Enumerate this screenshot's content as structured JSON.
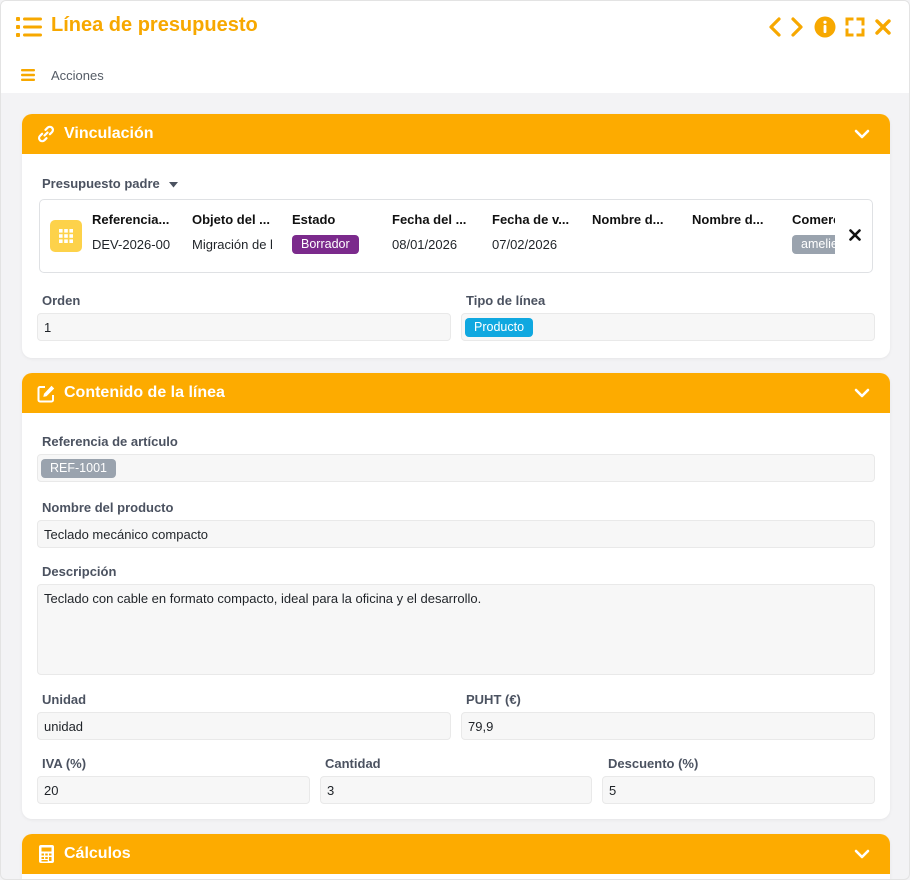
{
  "window": {
    "title": "Línea de presupuesto",
    "actions_label": "Acciones",
    "accent": "#fdab00",
    "title_color": "#f7a800",
    "header_icons": [
      "chevron-left-icon",
      "chevron-right-icon",
      "info-icon",
      "expand-icon",
      "close-icon"
    ]
  },
  "vinculacion": {
    "title": "Vinculación",
    "parent_label": "Presupuesto padre",
    "columns": [
      {
        "header": "Referencia del presupuesto",
        "header_short": "Referencia...",
        "value": "DEV-2026-00"
      },
      {
        "header": "Objeto del presupuesto",
        "header_short": "Objeto del ...",
        "value": "Migración de l"
      },
      {
        "header": "Estado",
        "header_short": "Estado",
        "value": "Borrador"
      },
      {
        "header": "Fecha del presupuesto",
        "header_short": "Fecha del ...",
        "value": "08/01/2026"
      },
      {
        "header": "Fecha de validez",
        "header_short": "Fecha de v...",
        "value": "07/02/2026"
      },
      {
        "header": "Nombre del cliente",
        "header_short": "Nombre d...",
        "value": ""
      },
      {
        "header": "Nombre del contacto",
        "header_short": "Nombre d...",
        "value": ""
      },
      {
        "header": "Comercial",
        "header_short": "Comerc",
        "value": "amelie"
      }
    ],
    "status_color": "#7b2a8c",
    "orden_label": "Orden",
    "orden_value": "1",
    "tipo_label": "Tipo de línea",
    "tipo_value": "Producto",
    "tipo_color": "#10a8e0"
  },
  "contenido": {
    "title": "Contenido de la línea",
    "ref_label": "Referencia de artículo",
    "ref_value": "REF-1001",
    "nombre_label": "Nombre del producto",
    "nombre_value": "Teclado mecánico compacto",
    "desc_label": "Descripción",
    "desc_value": "Teclado con cable en formato compacto, ideal para la oficina y el desarrollo.",
    "unidad_label": "Unidad",
    "unidad_value": "unidad",
    "puht_label": "PUHT (€)",
    "puht_value": "79,9",
    "iva_label": "IVA (%)",
    "iva_value": "20",
    "cantidad_label": "Cantidad",
    "cantidad_value": "3",
    "descuento_label": "Descuento (%)",
    "descuento_value": "5"
  },
  "calculos": {
    "title": "Cálculos"
  }
}
